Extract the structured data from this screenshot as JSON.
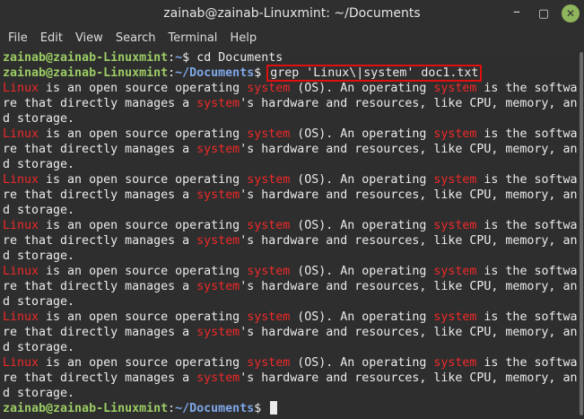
{
  "window": {
    "title": "zainab@zainab-Linuxmint: ~/Documents",
    "controls": {
      "minimize": "–",
      "maximize": "▢",
      "close": "✕"
    }
  },
  "menu": [
    "File",
    "Edit",
    "View",
    "Search",
    "Terminal",
    "Help"
  ],
  "prompt": {
    "user_host": "zainab@zainab-Linuxmint",
    "home_path": "~",
    "docs_path": "~/Documents",
    "symbol": "$"
  },
  "commands": {
    "first": "cd Documents",
    "second": "grep 'Linux\\|system' doc1.txt"
  },
  "output": {
    "repeat_count": 7,
    "line1": [
      {
        "t": "Linux",
        "hl": true
      },
      {
        "t": " is an open source operating ",
        "hl": false
      },
      {
        "t": "system",
        "hl": true
      },
      {
        "t": " (OS). An operating ",
        "hl": false
      },
      {
        "t": "system",
        "hl": true
      },
      {
        "t": " is the softwa",
        "hl": false
      }
    ],
    "line2": [
      {
        "t": "re that directly manages a ",
        "hl": false
      },
      {
        "t": "system",
        "hl": true
      },
      {
        "t": "'s hardware and resources, like CPU, memory, an",
        "hl": false
      }
    ],
    "line3": [
      {
        "t": "d storage.",
        "hl": false
      }
    ]
  },
  "colors": {
    "background": "#2e2e2e",
    "user": "#9ccc65",
    "path": "#7fa7e8",
    "match": "#ef2929",
    "annotation_box": "#e01010",
    "close_button": "#8fb55d"
  }
}
